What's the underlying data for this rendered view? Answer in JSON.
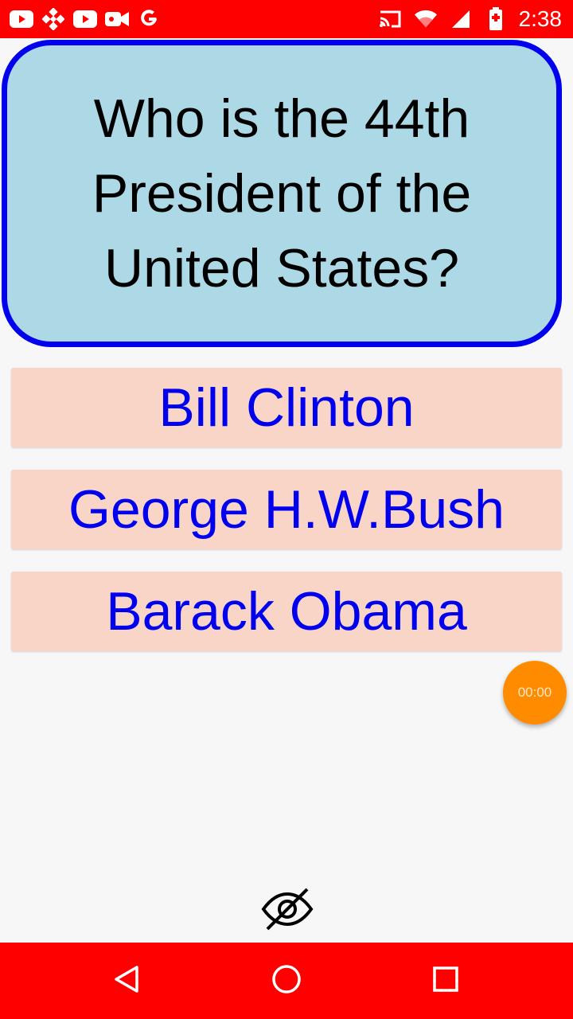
{
  "status_bar": {
    "time": "2:38",
    "color": "#ff0000",
    "left_icons": [
      "youtube-icon",
      "binance-icon",
      "youtube-icon",
      "video-camera-icon",
      "google-icon"
    ],
    "right_icons": [
      "cast-icon",
      "wifi-icon",
      "signal-icon",
      "battery-icon"
    ]
  },
  "question": {
    "text": "Who is the 44th President of the United States?",
    "background": "#add8e6",
    "border_color": "#0000ee"
  },
  "answers": [
    {
      "label": "Bill Clinton"
    },
    {
      "label": "George H.W.Bush"
    },
    {
      "label": "Barack Obama"
    }
  ],
  "answer_style": {
    "background": "#f9d5c8",
    "text_color": "#0000ee"
  },
  "timer": {
    "label": "00:00",
    "color": "#ff8c00"
  },
  "hide_toggle": {
    "icon": "eye-off-icon"
  },
  "nav_bar": {
    "color": "#ff0000",
    "buttons": [
      "back-icon",
      "home-icon",
      "recents-icon"
    ]
  }
}
